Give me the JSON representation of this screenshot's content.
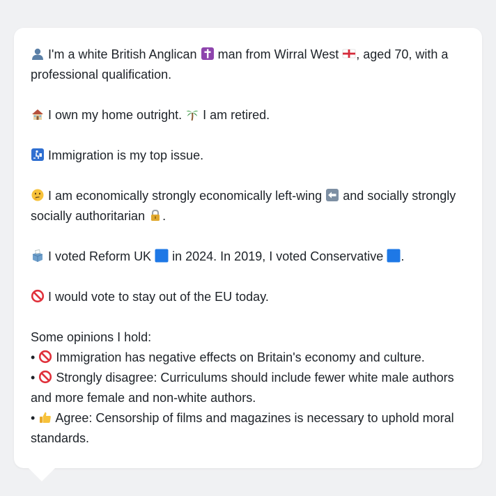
{
  "profile": {
    "line1": {
      "t1": "I'm a white British Anglican",
      "t2": "man from Wirral West",
      "t3": ", aged 70, with a professional qualification."
    },
    "line2": {
      "t1": "I own my home outright.",
      "t2": "I am retired."
    },
    "line3": {
      "t1": "Immigration is my top issue."
    },
    "line4": {
      "t1": "I am economically strongly economically left-wing",
      "t2": "and socially strongly socially authoritarian",
      "t3": "."
    },
    "line5": {
      "t1": "I voted Reform UK",
      "t2": "in 2024. In 2019, I voted Conservative",
      "t3": "."
    },
    "line6": {
      "t1": "I would vote to stay out of the EU today."
    }
  },
  "opinions": {
    "heading": "Some opinions I hold:",
    "bullet": "•",
    "items": [
      {
        "text": "Immigration has negative effects on Britain's economy and culture."
      },
      {
        "text": "Strongly disagree: Curriculums should include fewer white male authors and more female and non-white authors."
      },
      {
        "text": "Agree: Censorship of films and magazines is necessary to uphold moral standards."
      }
    ]
  },
  "icons": {
    "person": "bust-silhouette-icon",
    "cross": "latin-cross-icon",
    "flag": "england-flag-icon",
    "house": "house-icon",
    "palm": "palm-tree-icon",
    "passport": "passport-control-icon",
    "thinking": "thinking-face-icon",
    "left_arrow": "left-arrow-icon",
    "lock": "locked-padlock-icon",
    "ballot": "ballot-box-icon",
    "blue_square": "blue-square-icon",
    "prohibited": "prohibited-icon",
    "thumbs_up": "thumbs-up-icon"
  },
  "colors": {
    "background": "#f0f1f3",
    "bubble": "#ffffff",
    "text": "#1d2228",
    "reform_blue": "#1e78e6",
    "conservative_blue": "#1e78e6",
    "prohibited_red": "#e0313b"
  }
}
